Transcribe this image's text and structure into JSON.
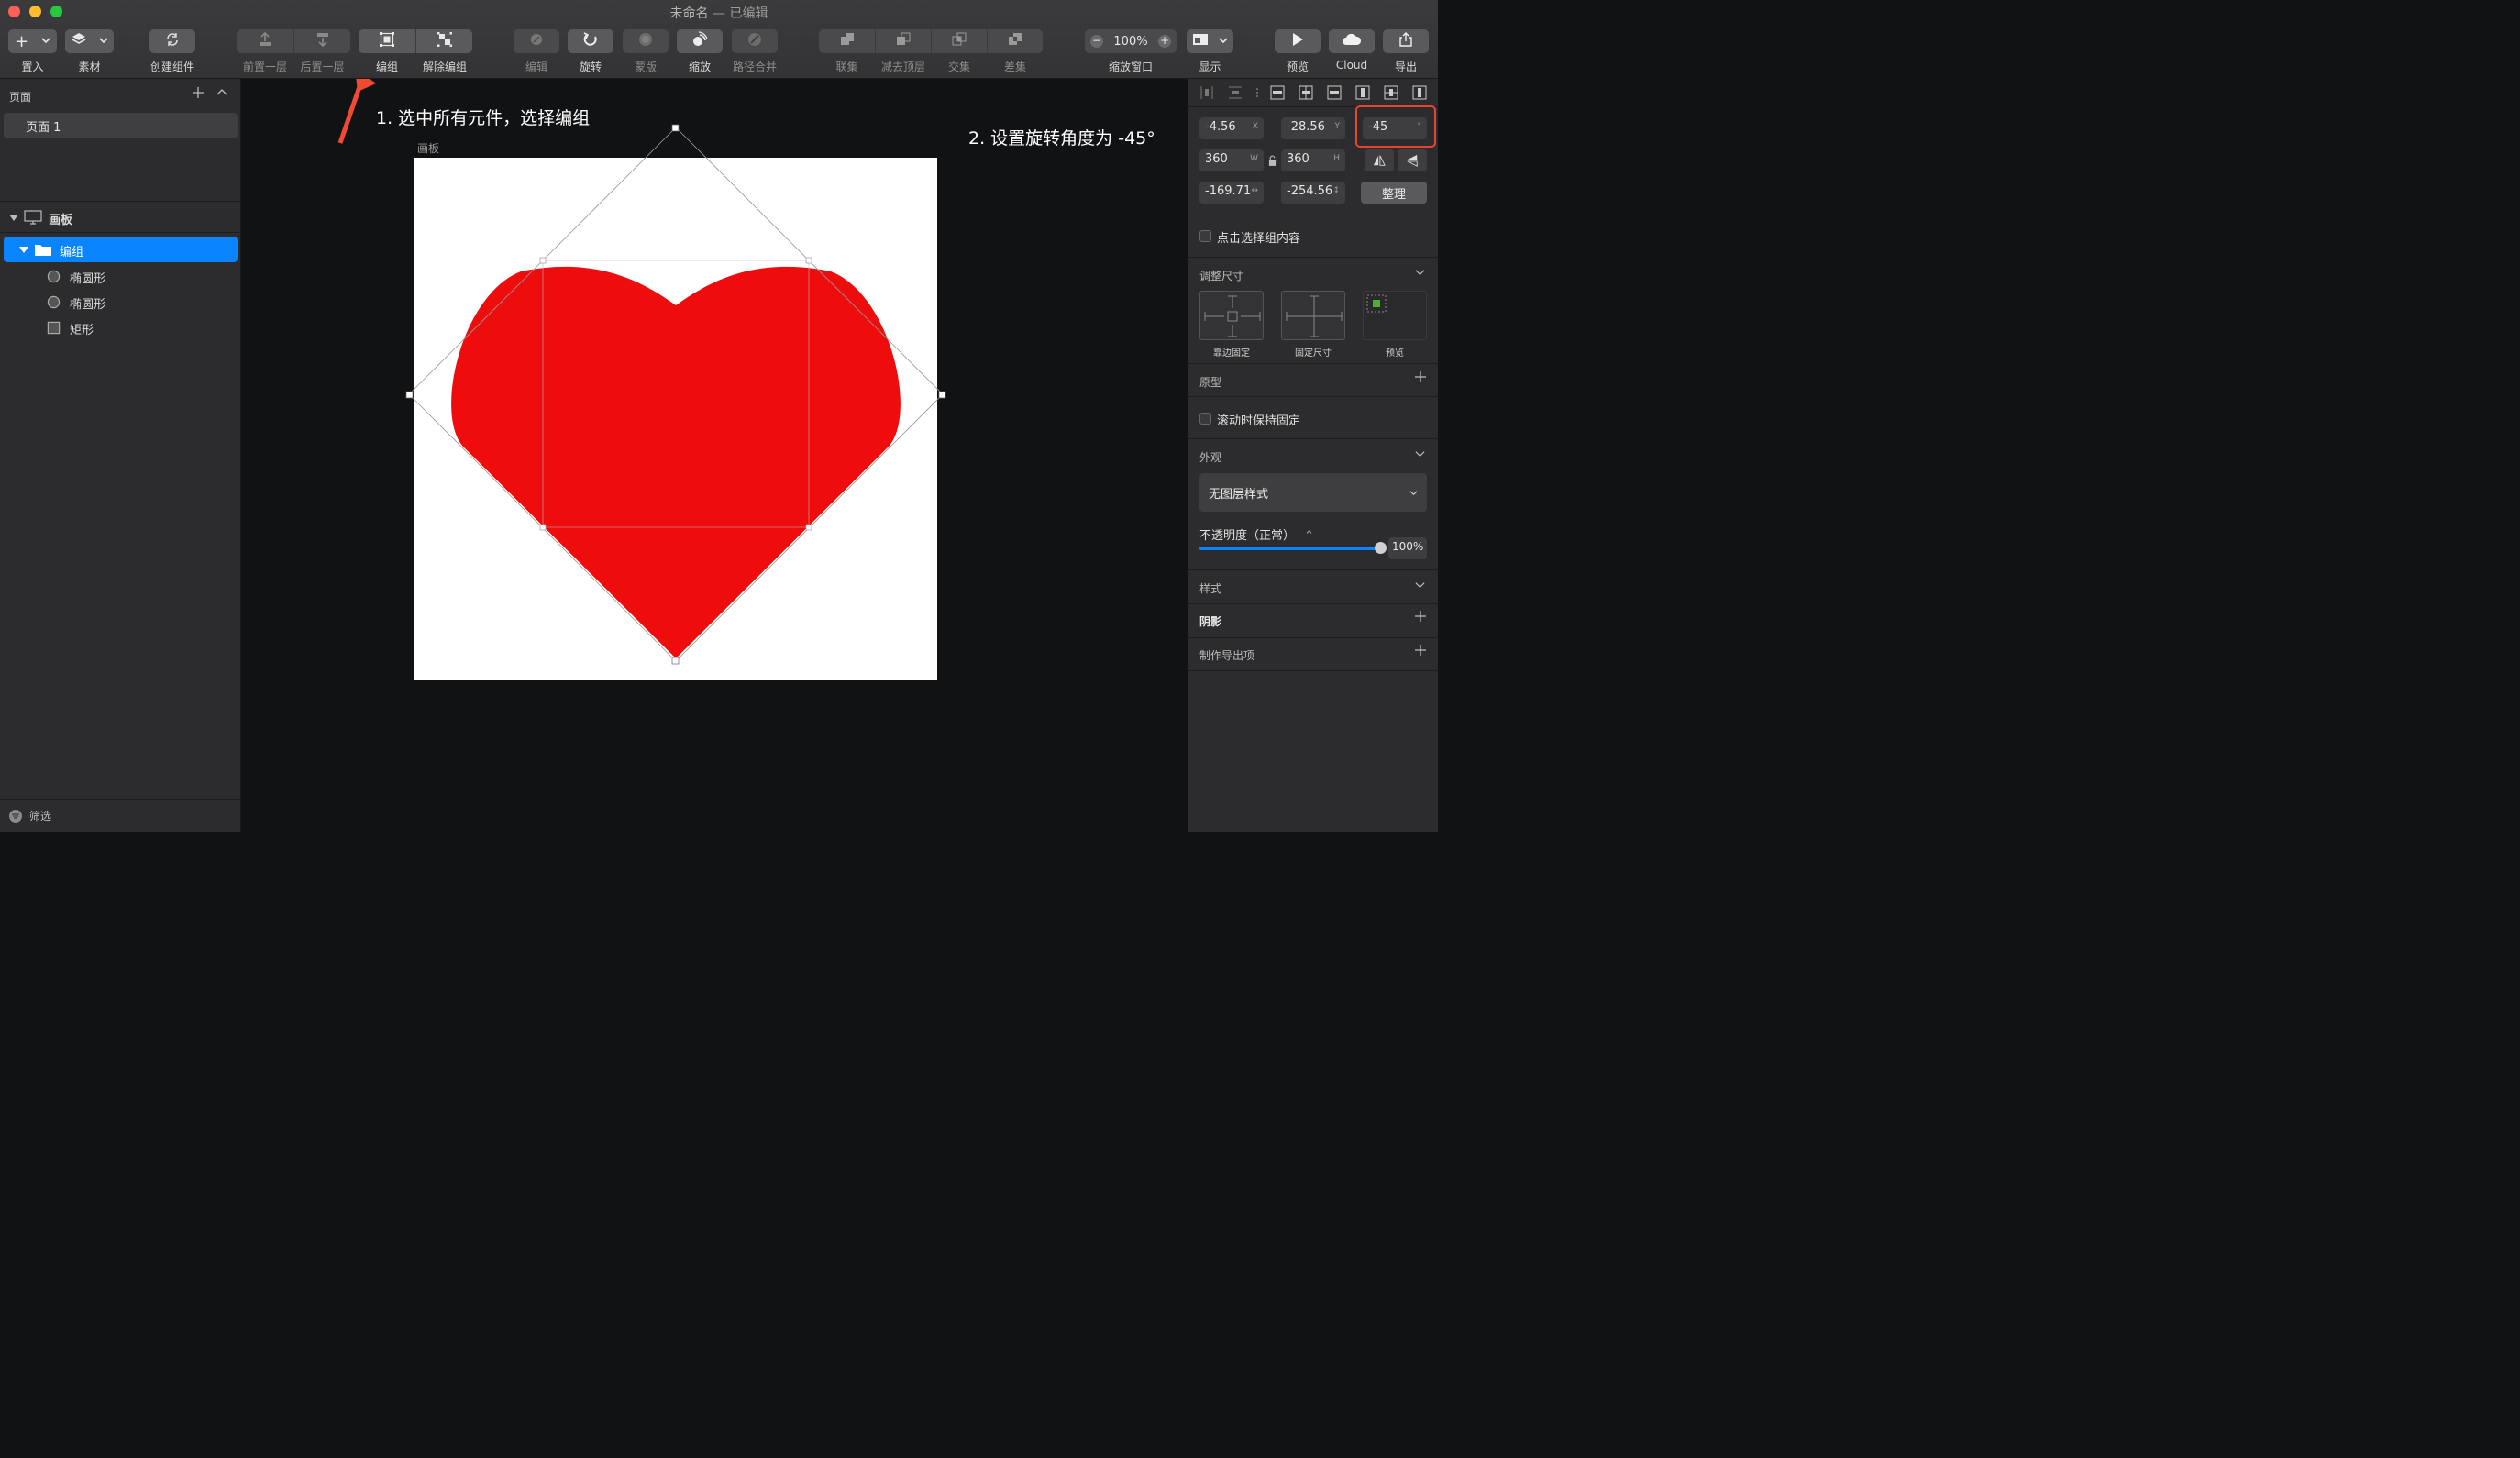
{
  "window": {
    "title_main": "未命名",
    "title_suffix": " — 已编辑"
  },
  "toolbar": {
    "items": [
      {
        "id": "insert",
        "label": "置入"
      },
      {
        "id": "assets",
        "label": "素材"
      },
      {
        "id": "create_component",
        "label": "创建组件"
      },
      {
        "id": "forward",
        "label": "前置一层"
      },
      {
        "id": "backward",
        "label": "后置一层"
      },
      {
        "id": "group",
        "label": "编组"
      },
      {
        "id": "ungroup",
        "label": "解除编组"
      },
      {
        "id": "edit",
        "label": "编辑"
      },
      {
        "id": "rotate",
        "label": "旋转"
      },
      {
        "id": "mask",
        "label": "蒙版"
      },
      {
        "id": "scale",
        "label": "缩放"
      },
      {
        "id": "path_merge",
        "label": "路径合并"
      },
      {
        "id": "union",
        "label": "联集"
      },
      {
        "id": "subtract",
        "label": "减去顶层"
      },
      {
        "id": "intersect",
        "label": "交集"
      },
      {
        "id": "difference",
        "label": "差集"
      },
      {
        "id": "zoom",
        "label": "缩放窗口"
      },
      {
        "id": "view",
        "label": "显示"
      },
      {
        "id": "preview",
        "label": "预览"
      },
      {
        "id": "cloud",
        "label": "Cloud"
      },
      {
        "id": "export",
        "label": "导出"
      }
    ],
    "zoom_value": "100%",
    "zoom_minus": "−",
    "zoom_plus": "+",
    "insert_plus": "+"
  },
  "sidebar": {
    "pages_header": "页面",
    "pages": [
      "页面 1"
    ],
    "artboard_name": "画板",
    "layers": [
      {
        "name": "编组",
        "kind": "group",
        "selected": true
      },
      {
        "name": "椭圆形",
        "kind": "oval"
      },
      {
        "name": "椭圆形",
        "kind": "oval"
      },
      {
        "name": "矩形",
        "kind": "rect"
      }
    ],
    "filter_label": "筛选"
  },
  "canvas": {
    "artboard_label": "画板",
    "annotation_1": "1. 选中所有元件，选择编组",
    "annotation_2": "2. 设置旋转角度为 -45°",
    "heart_color": "#ee0c0c",
    "arrow_color": "#f04a30"
  },
  "inspector": {
    "x": "-4.56",
    "x_unit": "X",
    "y": "-28.56",
    "y_unit": "Y",
    "rotation": "-45",
    "rotation_unit": "°",
    "w": "360",
    "w_unit": "W",
    "h": "360",
    "h_unit": "H",
    "sx": "-169.71",
    "sx_unit": "↔",
    "sy": "-254.56",
    "sy_unit": "↕",
    "tidy_label": "整理",
    "click_select_label": "点击选择组内容",
    "resize_header": "调整尺寸",
    "resize_opts": [
      "靠边固定",
      "固定尺寸",
      "预览"
    ],
    "prototype_header": "原型",
    "fix_scroll_label": "滚动时保持固定",
    "appearance_header": "外观",
    "style_value": "无图层样式",
    "opacity_label": "不透明度（正常）",
    "opacity_value": "100%",
    "opacity": 1.0,
    "style_header": "样式",
    "shadow_header": "阴影",
    "export_header": "制作导出项",
    "accent_color": "#0a84ff",
    "highlight_color": "#e8432f"
  }
}
